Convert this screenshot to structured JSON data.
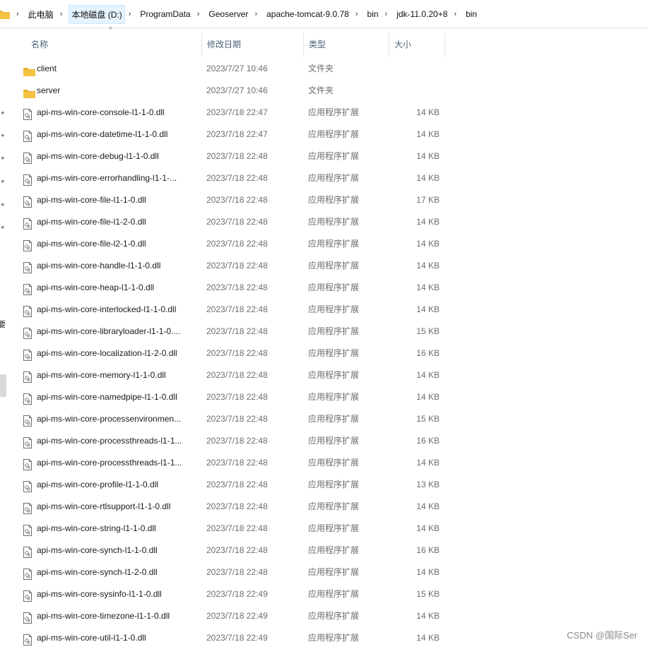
{
  "breadcrumb": [
    "此电脑",
    "本地磁盘 (D:)",
    "ProgramData",
    "Geoserver",
    "apache-tomcat-9.0.78",
    "bin",
    "jdk-11.0.20+8",
    "bin"
  ],
  "left_pane": {
    "cut_glyph": "要"
  },
  "columns": {
    "name": "名称",
    "date": "修改日期",
    "type": "类型",
    "size": "大小"
  },
  "files": [
    {
      "name": "client",
      "date": "2023/7/27 10:46",
      "type": "文件夹",
      "size": "",
      "icon": "folder-icon"
    },
    {
      "name": "server",
      "date": "2023/7/27 10:46",
      "type": "文件夹",
      "size": "",
      "icon": "folder-icon"
    },
    {
      "name": "api-ms-win-core-console-l1-1-0.dll",
      "date": "2023/7/18 22:47",
      "type": "应用程序扩展",
      "size": "14 KB",
      "icon": "dll-file-icon"
    },
    {
      "name": "api-ms-win-core-datetime-l1-1-0.dll",
      "date": "2023/7/18 22:47",
      "type": "应用程序扩展",
      "size": "14 KB",
      "icon": "dll-file-icon"
    },
    {
      "name": "api-ms-win-core-debug-l1-1-0.dll",
      "date": "2023/7/18 22:48",
      "type": "应用程序扩展",
      "size": "14 KB",
      "icon": "dll-file-icon"
    },
    {
      "name": "api-ms-win-core-errorhandling-l1-1-...",
      "date": "2023/7/18 22:48",
      "type": "应用程序扩展",
      "size": "14 KB",
      "icon": "dll-file-icon"
    },
    {
      "name": "api-ms-win-core-file-l1-1-0.dll",
      "date": "2023/7/18 22:48",
      "type": "应用程序扩展",
      "size": "17 KB",
      "icon": "dll-file-icon"
    },
    {
      "name": "api-ms-win-core-file-l1-2-0.dll",
      "date": "2023/7/18 22:48",
      "type": "应用程序扩展",
      "size": "14 KB",
      "icon": "dll-file-icon"
    },
    {
      "name": "api-ms-win-core-file-l2-1-0.dll",
      "date": "2023/7/18 22:48",
      "type": "应用程序扩展",
      "size": "14 KB",
      "icon": "dll-file-icon"
    },
    {
      "name": "api-ms-win-core-handle-l1-1-0.dll",
      "date": "2023/7/18 22:48",
      "type": "应用程序扩展",
      "size": "14 KB",
      "icon": "dll-file-icon"
    },
    {
      "name": "api-ms-win-core-heap-l1-1-0.dll",
      "date": "2023/7/18 22:48",
      "type": "应用程序扩展",
      "size": "14 KB",
      "icon": "dll-file-icon"
    },
    {
      "name": "api-ms-win-core-interlocked-l1-1-0.dll",
      "date": "2023/7/18 22:48",
      "type": "应用程序扩展",
      "size": "14 KB",
      "icon": "dll-file-icon"
    },
    {
      "name": "api-ms-win-core-libraryloader-l1-1-0....",
      "date": "2023/7/18 22:48",
      "type": "应用程序扩展",
      "size": "15 KB",
      "icon": "dll-file-icon"
    },
    {
      "name": "api-ms-win-core-localization-l1-2-0.dll",
      "date": "2023/7/18 22:48",
      "type": "应用程序扩展",
      "size": "16 KB",
      "icon": "dll-file-icon"
    },
    {
      "name": "api-ms-win-core-memory-l1-1-0.dll",
      "date": "2023/7/18 22:48",
      "type": "应用程序扩展",
      "size": "14 KB",
      "icon": "dll-file-icon"
    },
    {
      "name": "api-ms-win-core-namedpipe-l1-1-0.dll",
      "date": "2023/7/18 22:48",
      "type": "应用程序扩展",
      "size": "14 KB",
      "icon": "dll-file-icon"
    },
    {
      "name": "api-ms-win-core-processenvironmen...",
      "date": "2023/7/18 22:48",
      "type": "应用程序扩展",
      "size": "15 KB",
      "icon": "dll-file-icon"
    },
    {
      "name": "api-ms-win-core-processthreads-l1-1...",
      "date": "2023/7/18 22:48",
      "type": "应用程序扩展",
      "size": "16 KB",
      "icon": "dll-file-icon"
    },
    {
      "name": "api-ms-win-core-processthreads-l1-1...",
      "date": "2023/7/18 22:48",
      "type": "应用程序扩展",
      "size": "14 KB",
      "icon": "dll-file-icon"
    },
    {
      "name": "api-ms-win-core-profile-l1-1-0.dll",
      "date": "2023/7/18 22:48",
      "type": "应用程序扩展",
      "size": "13 KB",
      "icon": "dll-file-icon"
    },
    {
      "name": "api-ms-win-core-rtlsupport-l1-1-0.dll",
      "date": "2023/7/18 22:48",
      "type": "应用程序扩展",
      "size": "14 KB",
      "icon": "dll-file-icon"
    },
    {
      "name": "api-ms-win-core-string-l1-1-0.dll",
      "date": "2023/7/18 22:48",
      "type": "应用程序扩展",
      "size": "14 KB",
      "icon": "dll-file-icon"
    },
    {
      "name": "api-ms-win-core-synch-l1-1-0.dll",
      "date": "2023/7/18 22:48",
      "type": "应用程序扩展",
      "size": "16 KB",
      "icon": "dll-file-icon"
    },
    {
      "name": "api-ms-win-core-synch-l1-2-0.dll",
      "date": "2023/7/18 22:48",
      "type": "应用程序扩展",
      "size": "14 KB",
      "icon": "dll-file-icon"
    },
    {
      "name": "api-ms-win-core-sysinfo-l1-1-0.dll",
      "date": "2023/7/18 22:49",
      "type": "应用程序扩展",
      "size": "15 KB",
      "icon": "dll-file-icon"
    },
    {
      "name": "api-ms-win-core-timezone-l1-1-0.dll",
      "date": "2023/7/18 22:49",
      "type": "应用程序扩展",
      "size": "14 KB",
      "icon": "dll-file-icon"
    },
    {
      "name": "api-ms-win-core-util-l1-1-0.dll",
      "date": "2023/7/18 22:49",
      "type": "应用程序扩展",
      "size": "14 KB",
      "icon": "dll-file-icon"
    }
  ],
  "watermark": "CSDN @国际Ser",
  "colors": {
    "folder": "#f5c342",
    "header_text": "#4c607a",
    "highlight": "#e5f3ff"
  }
}
